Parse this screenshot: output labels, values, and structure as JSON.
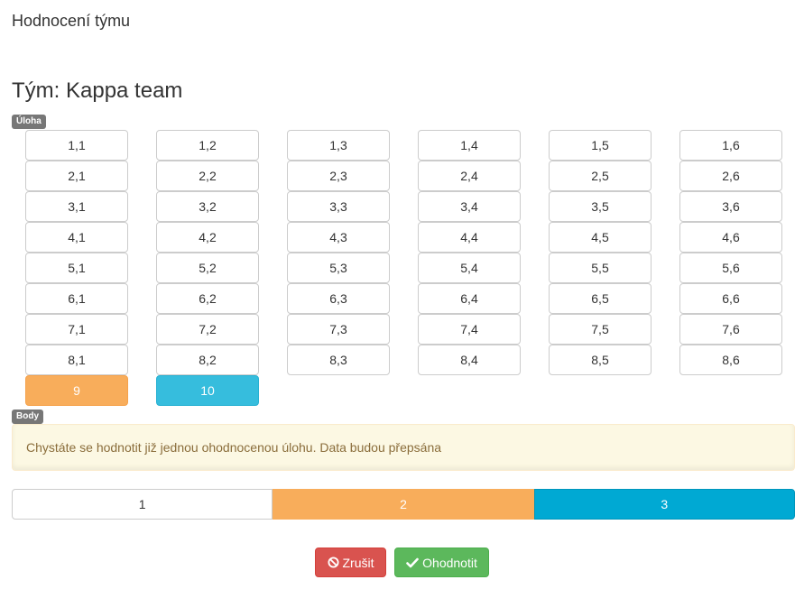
{
  "header": {
    "app_title": "Hodnocení týmu"
  },
  "team": {
    "title": "Tým: Kappa team"
  },
  "labels": {
    "task": "Úloha",
    "points": "Body"
  },
  "tasks": [
    [
      "1,1",
      "1,2",
      "1,3",
      "1,4",
      "1,5",
      "1,6"
    ],
    [
      "2,1",
      "2,2",
      "2,3",
      "2,4",
      "2,5",
      "2,6"
    ],
    [
      "3,1",
      "3,2",
      "3,3",
      "3,4",
      "3,5",
      "3,6"
    ],
    [
      "4,1",
      "4,2",
      "4,3",
      "4,4",
      "4,5",
      "4,6"
    ],
    [
      "5,1",
      "5,2",
      "5,3",
      "5,4",
      "5,5",
      "5,6"
    ],
    [
      "6,1",
      "6,2",
      "6,3",
      "6,4",
      "6,5",
      "6,6"
    ],
    [
      "7,1",
      "7,2",
      "7,3",
      "7,4",
      "7,5",
      "7,6"
    ],
    [
      "8,1",
      "8,2",
      "8,3",
      "8,4",
      "8,5",
      "8,6"
    ]
  ],
  "extra_tasks": [
    {
      "label": "9",
      "color": "#f8ad5b"
    },
    {
      "label": "10",
      "color": "#36bddd"
    }
  ],
  "alert": {
    "text": "Chystáte se hodnotit již jednou ohodnocenou úlohu. Data budou přepsána"
  },
  "points": [
    {
      "label": "1",
      "color": "#ffffff"
    },
    {
      "label": "2",
      "color": "#f8ad5b"
    },
    {
      "label": "3",
      "color": "#00a9d3"
    }
  ],
  "actions": {
    "cancel_label": "Zrušit",
    "cancel_icon": "ban-icon",
    "submit_label": "Ohodnotit",
    "submit_icon": "check-icon"
  }
}
